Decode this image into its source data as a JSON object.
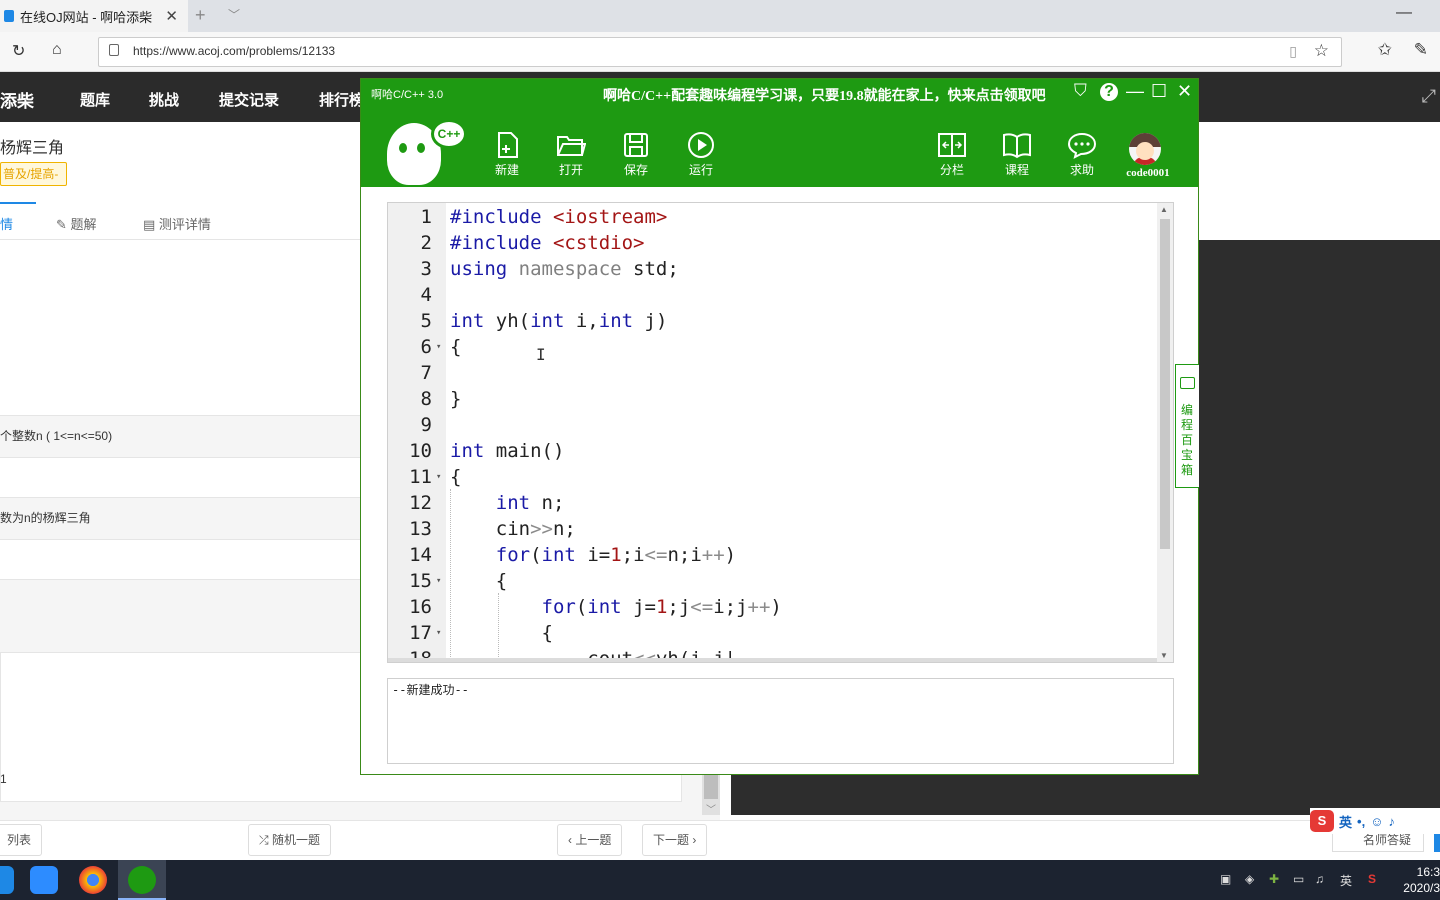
{
  "browser": {
    "tab_title": "在线OJ网站 - 啊哈添柴",
    "url": "https://www.acoj.com/problems/12133"
  },
  "site": {
    "brand": "添柴",
    "nav": [
      "题库",
      "挑战",
      "提交记录",
      "排行榜"
    ],
    "problem_title": "杨辉三角",
    "level_badge": "普及/提高-",
    "tabs": [
      "情",
      "题解",
      "测评详情"
    ],
    "input_desc": "个整数n ( 1<=n<=50)",
    "output_desc": "数为n的杨辉三角",
    "sample_value": "1",
    "bottom_buttons": [
      "列表",
      "随机一题",
      "上一题",
      "下一题"
    ],
    "ask_button": "名师答疑"
  },
  "ide": {
    "title": "啊哈C/C++ 3.0",
    "promo": "啊哈C/C++配套趣味编程学习课，只要19.8就能在家上，快来点击领取吧",
    "logo_text": "C++",
    "toolbar": [
      {
        "label": "新建",
        "icon": "new-file-icon"
      },
      {
        "label": "打开",
        "icon": "open-folder-icon"
      },
      {
        "label": "保存",
        "icon": "save-icon"
      },
      {
        "label": "运行",
        "icon": "run-icon"
      }
    ],
    "right_toolbar": [
      {
        "label": "分栏",
        "icon": "split-icon"
      },
      {
        "label": "课程",
        "icon": "book-icon"
      },
      {
        "label": "求助",
        "icon": "chat-icon"
      }
    ],
    "username": "code0001",
    "output_message": "--新建成功--",
    "side_tab": "编程百宝箱"
  },
  "code_lines": [
    {
      "n": "1",
      "fold": ""
    },
    {
      "n": "2",
      "fold": ""
    },
    {
      "n": "3",
      "fold": ""
    },
    {
      "n": "4",
      "fold": ""
    },
    {
      "n": "5",
      "fold": ""
    },
    {
      "n": "6",
      "fold": "▾"
    },
    {
      "n": "7",
      "fold": ""
    },
    {
      "n": "8",
      "fold": ""
    },
    {
      "n": "9",
      "fold": ""
    },
    {
      "n": "10",
      "fold": ""
    },
    {
      "n": "11",
      "fold": "▾"
    },
    {
      "n": "12",
      "fold": ""
    },
    {
      "n": "13",
      "fold": ""
    },
    {
      "n": "14",
      "fold": ""
    },
    {
      "n": "15",
      "fold": "▾"
    },
    {
      "n": "16",
      "fold": ""
    },
    {
      "n": "17",
      "fold": "▾"
    },
    {
      "n": "18",
      "fold": ""
    }
  ],
  "taskbar": {
    "time": "16:3",
    "date": "2020/3",
    "ime": "英"
  },
  "colors": {
    "ide_green": "#1e9a12",
    "site_nav": "#2b2b2b",
    "taskbar": "#1c2330"
  }
}
